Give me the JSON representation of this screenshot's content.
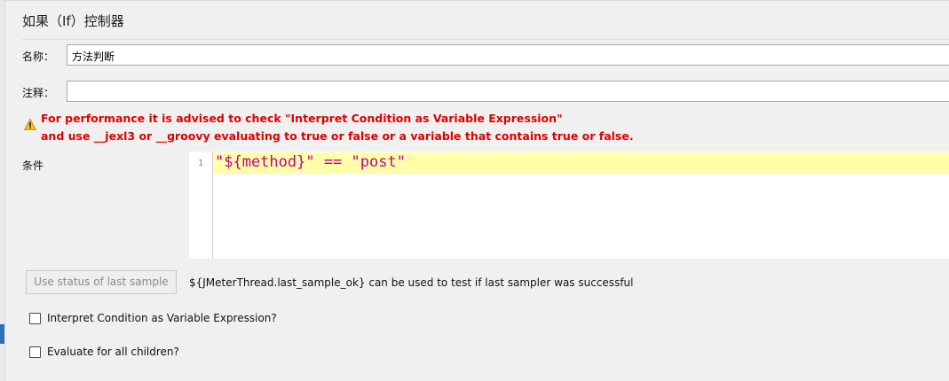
{
  "panel": {
    "title": "如果（If）控制器"
  },
  "fields": {
    "name_label": "名称：",
    "name_value": "方法判断",
    "comment_label": "注释：",
    "comment_value": ""
  },
  "warning": {
    "icon": "warning-icon",
    "line1": "For performance it is advised to check \"Interpret Condition as Variable Expression\"",
    "line2": "and use __jexl3 or __groovy evaluating to true or false or a variable that contains true or false.",
    "color": "#e00000"
  },
  "condition": {
    "label": "条件",
    "line_number": "1",
    "code": "\"${method}\" == \"post\"",
    "code_color": "#c4008a",
    "highlight_color": "#ffffaa"
  },
  "last_sample": {
    "button_label": "Use status of last sample",
    "hint": "${JMeterThread.last_sample_ok} can be used to test if last sampler was successful"
  },
  "options": {
    "interpret_label": "Interpret Condition as Variable Expression?",
    "interpret_checked": false,
    "evaluate_all_label": "Evaluate for all children?",
    "evaluate_all_checked": false
  }
}
